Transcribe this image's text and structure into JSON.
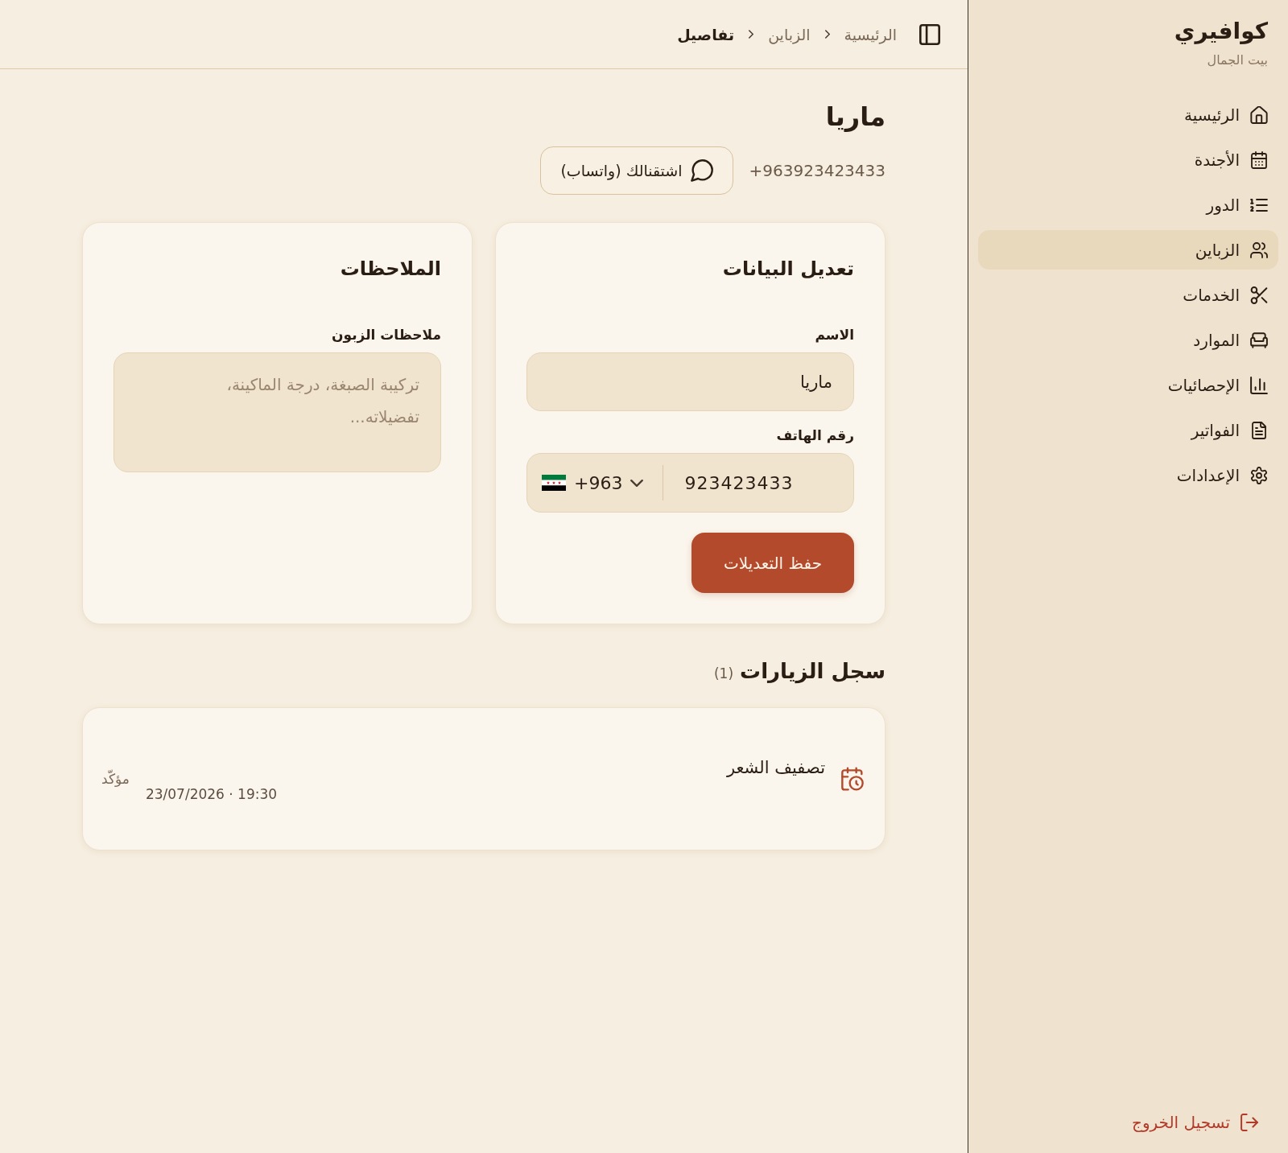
{
  "sidebar": {
    "brand": "كوافيري",
    "tagline": "بيت الجمال",
    "items": [
      {
        "kind": "home",
        "label": "الرئيسية",
        "selected": false
      },
      {
        "kind": "calendar",
        "label": "الأجندة",
        "selected": false
      },
      {
        "kind": "queue",
        "label": "الدور",
        "selected": false
      },
      {
        "kind": "customers",
        "label": "الزباين",
        "selected": true
      },
      {
        "kind": "services",
        "label": "الخدمات",
        "selected": false
      },
      {
        "kind": "resources",
        "label": "الموارد",
        "selected": false
      },
      {
        "kind": "statistics",
        "label": "الإحصائيات",
        "selected": false
      },
      {
        "kind": "invoices",
        "label": "الفواتير",
        "selected": false
      },
      {
        "kind": "settings",
        "label": "الإعدادات",
        "selected": false
      }
    ],
    "logout": "تسجيل الخروج"
  },
  "header": {
    "breadcrumbs": [
      {
        "label": "الرئيسية",
        "current": false
      },
      {
        "label": "الزباين",
        "current": false
      },
      {
        "label": "تفاصيل",
        "current": true
      }
    ]
  },
  "customer": {
    "name": "ماريا",
    "phone": "+963923423433",
    "whatsapp_button": "اشتقنالك (واتساب)"
  },
  "edit_form": {
    "title": "تعديل البيانات",
    "name_label": "الاسم",
    "name_value": "ماريا",
    "phone_label": "رقم الهاتف",
    "country_code": "+963",
    "phone_value": "923423433",
    "save_button": "حفظ التعديلات"
  },
  "notes": {
    "title": "الملاحظات",
    "label": "ملاحظات الزبون",
    "placeholder": "تركيبة الصبغة، درجة الماكينة، تفضيلاته..."
  },
  "visits": {
    "title": "سجل الزيارات",
    "count": "(1)",
    "items": [
      {
        "service": "تصفيف الشعر",
        "date": "23/07/2026 · 19:30",
        "status": "مؤكّد"
      }
    ]
  }
}
